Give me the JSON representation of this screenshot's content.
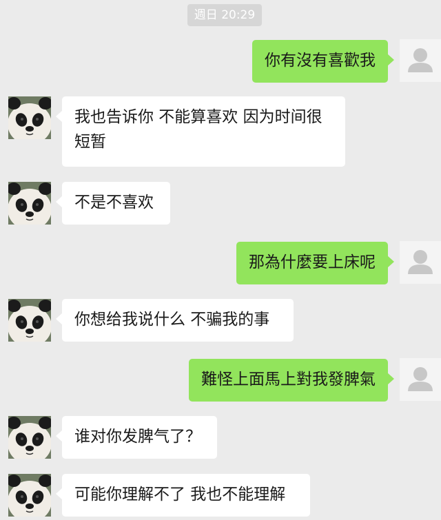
{
  "timestamp": "週日 20:29",
  "messages": [
    {
      "from": "me",
      "text": "你有沒有喜歡我"
    },
    {
      "from": "other",
      "text": "我也告诉你 不能算喜欢 因为时间很短暂"
    },
    {
      "from": "other",
      "text": "不是不喜欢"
    },
    {
      "from": "me",
      "text": "那為什麼要上床呢"
    },
    {
      "from": "other",
      "text": "你想给我说什么 不骗我的事"
    },
    {
      "from": "me",
      "text": "難怪上面馬上對我發脾氣"
    },
    {
      "from": "other",
      "text": "谁对你发脾气了？"
    },
    {
      "from": "other",
      "text": "可能你理解不了 我也不能理解"
    }
  ],
  "avatars": {
    "other": "panda-avatar-icon",
    "me": "default-user-avatar-icon"
  },
  "colors": {
    "background": "#ebebeb",
    "outgoing_bubble": "#92e45c",
    "incoming_bubble": "#ffffff"
  }
}
